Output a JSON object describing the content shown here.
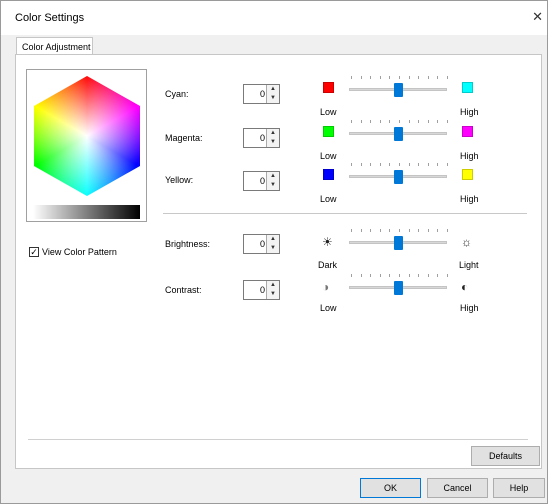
{
  "window": {
    "title": "Color Settings",
    "close_glyph": "✕"
  },
  "tabs": [
    {
      "label": "Color Adjustment"
    }
  ],
  "options": {
    "view_color_pattern": {
      "label": "View Color Pattern",
      "checked": true,
      "check_glyph": "✓"
    }
  },
  "adjustments": [
    {
      "label": "Cyan:",
      "value": "0",
      "low_label": "Low",
      "high_label": "High",
      "low_color": "#ff0000",
      "high_color": "#00ffff",
      "level": 0.5
    },
    {
      "label": "Magenta:",
      "value": "0",
      "low_label": "Low",
      "high_label": "High",
      "low_color": "#00ff00",
      "high_color": "#ff00ff",
      "level": 0.5
    },
    {
      "label": "Yellow:",
      "value": "0",
      "low_label": "Low",
      "high_label": "High",
      "low_color": "#0000ff",
      "high_color": "#ffff00",
      "level": 0.5
    },
    {
      "label": "Brightness:",
      "value": "0",
      "low_label": "Dark",
      "high_label": "Light",
      "low_icon": "sun-dark-icon",
      "high_icon": "sun-light-icon",
      "low_glyph": "☀",
      "high_glyph": "☼",
      "level": 0.5
    },
    {
      "label": "Contrast:",
      "value": "0",
      "low_label": "Low",
      "high_label": "High",
      "low_icon": "contrast-low-icon",
      "high_icon": "contrast-high-icon",
      "low_glyph": "◑",
      "high_glyph": "◐",
      "level": 0.5
    }
  ],
  "spin": {
    "up_glyph": "▲",
    "down_glyph": "▼"
  },
  "buttons": {
    "defaults": "Defaults",
    "ok": "OK",
    "cancel": "Cancel",
    "help": "Help"
  },
  "colors": {
    "slider_thumb": "#0078d7",
    "ok_border": "#0078d7"
  }
}
